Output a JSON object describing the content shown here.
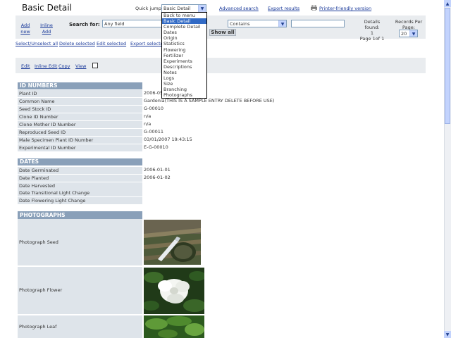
{
  "header": {
    "title": "Basic Detail",
    "quick_jump_label": "Quick jump:",
    "quick_jump_value": "Basic Detail",
    "advanced_search": "Advanced search",
    "export_results": "Export results",
    "printer_friendly": "Printer-friendly version"
  },
  "toolbar": {
    "add_new_1": "Add",
    "add_new_2": "new",
    "inline_add_1": "Inline",
    "inline_add_2": "Add",
    "search_for": "Search for:",
    "field_value": "Any field",
    "operator_value": "Contains",
    "show_all": "Show all",
    "details_found_1": "Details found:",
    "details_found_2": "1",
    "details_found_3": "Page 1of 1",
    "records_per_page_1": "Records Per",
    "records_per_page_2": "Page:",
    "records_per_page_value": "20"
  },
  "actions": {
    "select_unselect": "Select/Unselect all",
    "delete_selected": "Delete selected",
    "edit_selected": "Edit selected",
    "export_selected": "Export selected"
  },
  "record_actions": {
    "edit": "Edit",
    "inline_edit": "Inline Edit",
    "copy": "Copy",
    "view": "View"
  },
  "quick_jump_options": [
    "Back to menu",
    "Basic Detail",
    "Complete Detail",
    "Dates",
    "Origin",
    "Statistics",
    "Flowering",
    "Fertilizer",
    "Experiments",
    "Descriptions",
    "Notes",
    "Logs",
    "Size",
    "Branching",
    "Photographs"
  ],
  "sections": {
    "id_numbers": {
      "title": "ID NUMBERS",
      "rows": [
        {
          "label": "Plant ID",
          "value": "2006-05"
        },
        {
          "label": "Common Name",
          "value": "Gardenia(THIS IS A SAMPLE ENTRY DELETE BEFORE USE)"
        },
        {
          "label": "Seed Stock ID",
          "value": "G-00010"
        },
        {
          "label": "Clone ID Number",
          "value": "n/a"
        },
        {
          "label": "Clone Mother ID Number",
          "value": "n/a"
        },
        {
          "label": "Reproduced Seed ID",
          "value": "G-00011"
        },
        {
          "label": "Male Specimen Plant ID Number",
          "value": "03/01/2007 19:43:15"
        },
        {
          "label": "Experimental ID Number",
          "value": "E-G-00010"
        }
      ]
    },
    "dates": {
      "title": "DATES",
      "rows": [
        {
          "label": "Date Germinated",
          "value": "2006-01-01"
        },
        {
          "label": "Date Planted",
          "value": "2006-01-02"
        },
        {
          "label": "Date Harvested",
          "value": ""
        },
        {
          "label": "Date Transitional Light Change",
          "value": ""
        },
        {
          "label": "Date Flowering Light Change",
          "value": ""
        }
      ]
    },
    "photographs": {
      "title": "PHOTOGRAPHS",
      "rows": [
        {
          "label": "Photograph Seed"
        },
        {
          "label": "Photograph Flower"
        },
        {
          "label": "Photograph Leaf"
        }
      ]
    }
  },
  "colors": {
    "section_header": "#8aa0b9",
    "label_bg": "#dee4ea",
    "link": "#1a3a9a",
    "selection": "#316ac5"
  }
}
